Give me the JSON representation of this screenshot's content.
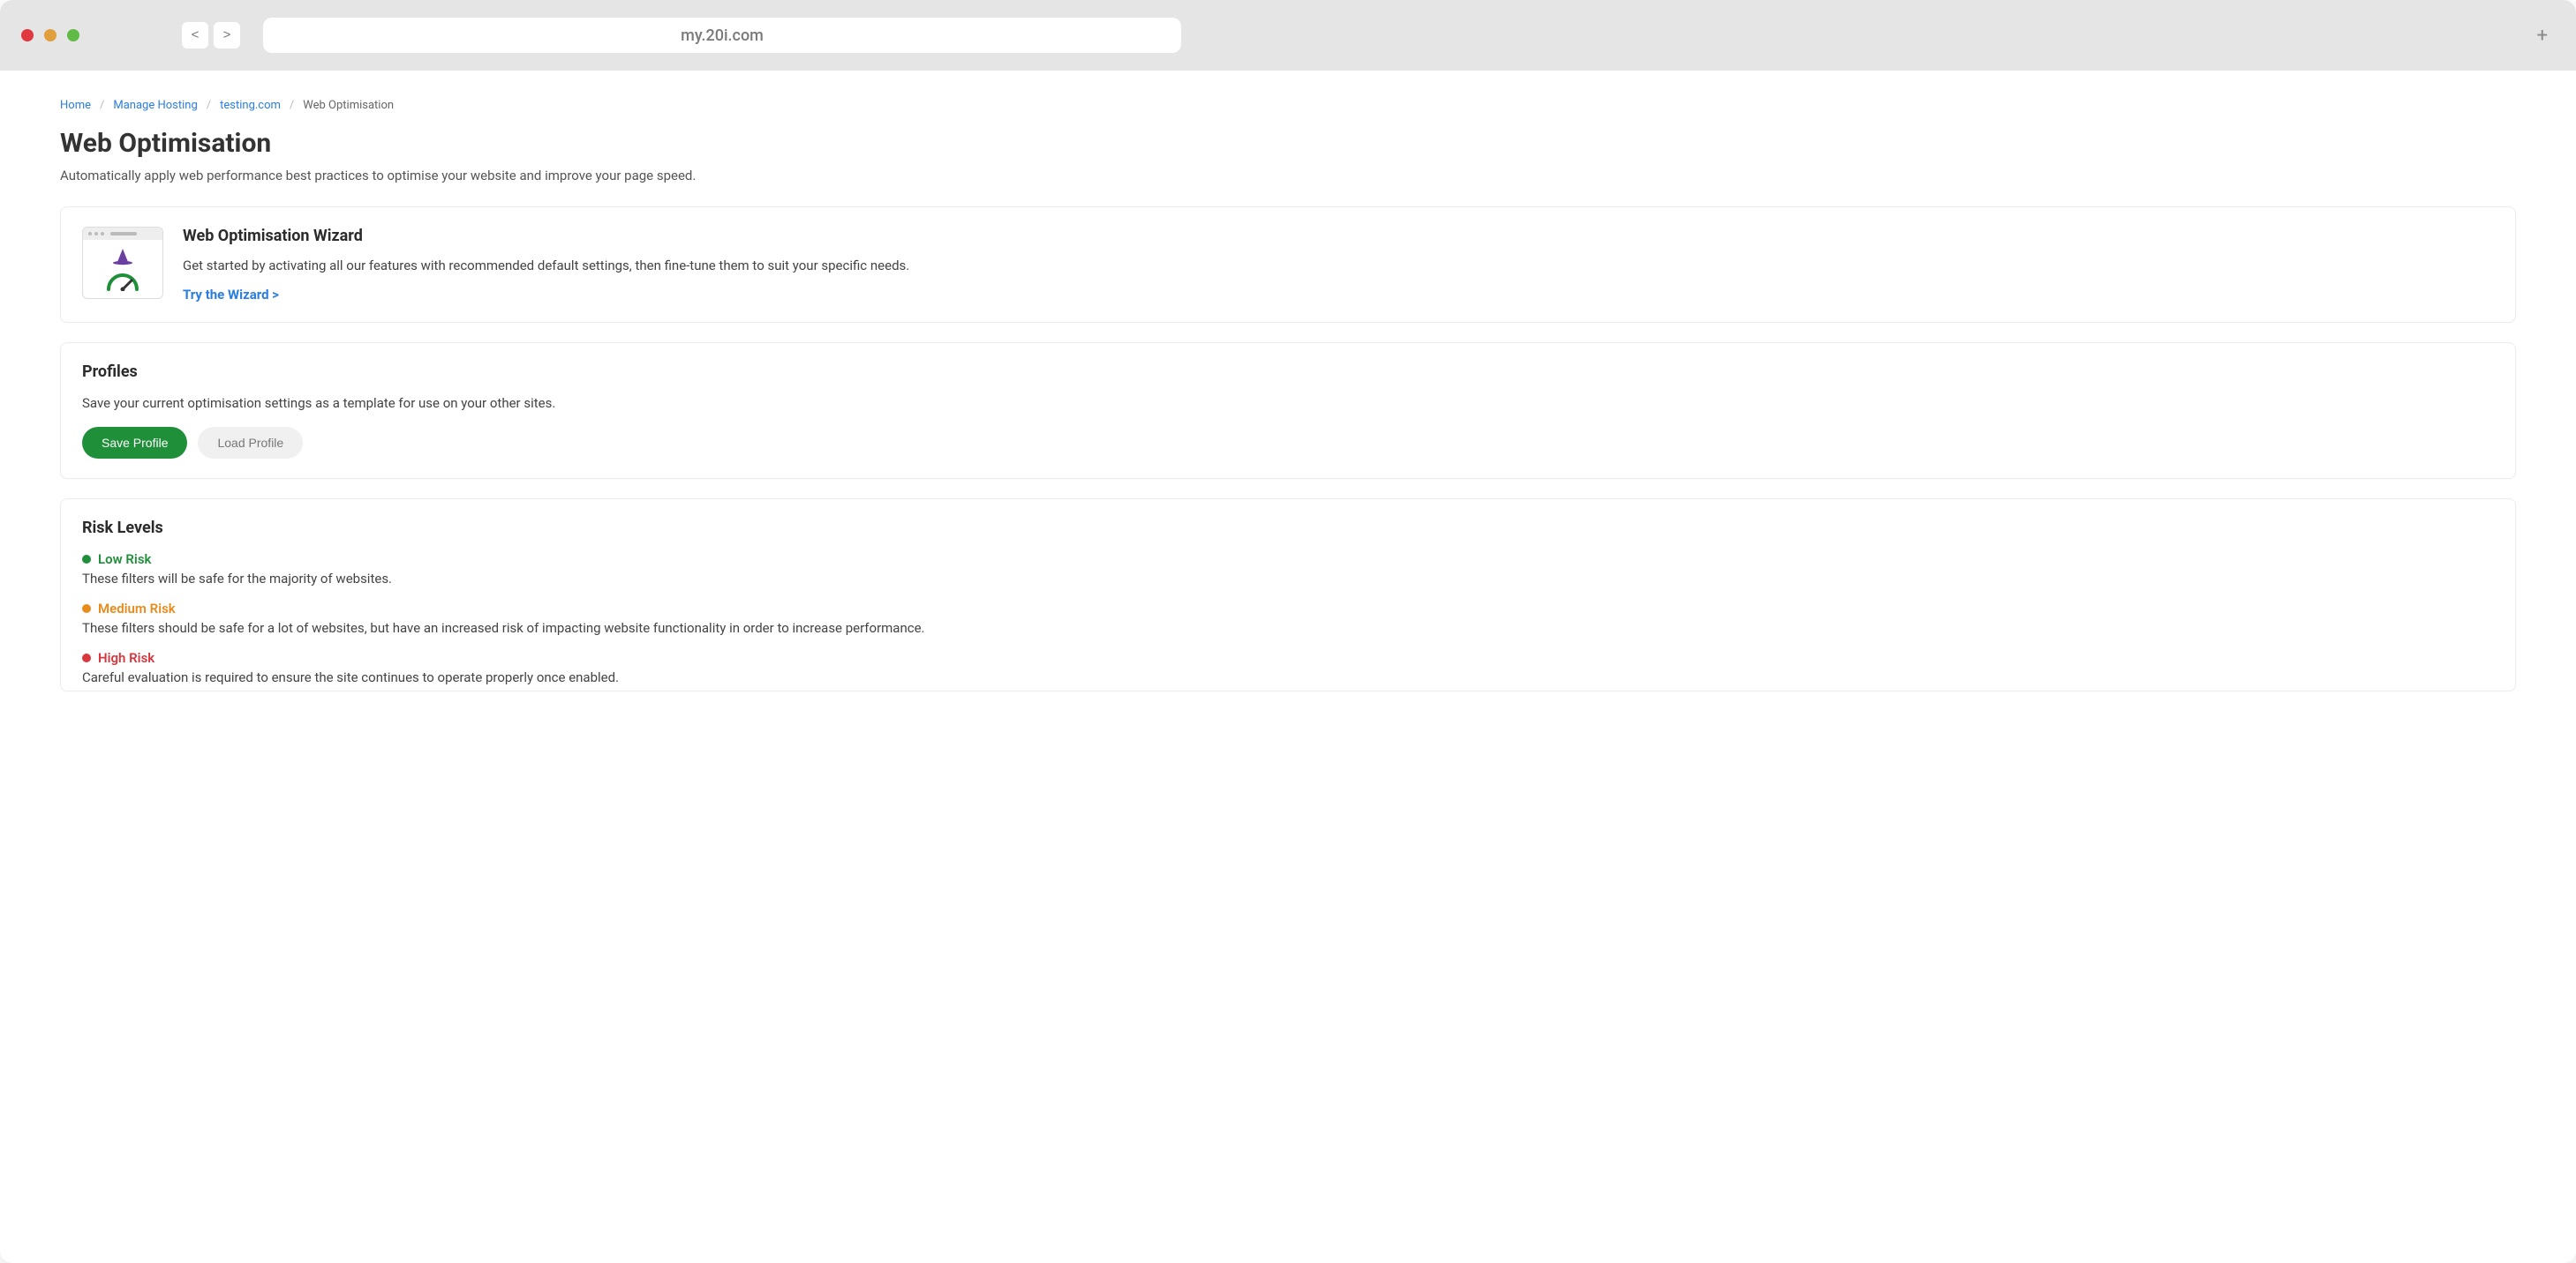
{
  "browser": {
    "url": "my.20i.com",
    "back_label": "<",
    "forward_label": ">",
    "new_tab_label": "+"
  },
  "breadcrumb": {
    "items": [
      {
        "label": "Home"
      },
      {
        "label": "Manage Hosting"
      },
      {
        "label": "testing.com"
      }
    ],
    "current": "Web Optimisation"
  },
  "page": {
    "title": "Web Optimisation",
    "subtitle": "Automatically apply web performance best practices to optimise your website and improve your page speed."
  },
  "wizard": {
    "title": "Web Optimisation Wizard",
    "description": "Get started by activating all our features with recommended default settings, then fine-tune them to suit your specific needs.",
    "link_label": "Try the Wizard >"
  },
  "profiles": {
    "heading": "Profiles",
    "description": "Save your current optimisation settings as a template for use on your other sites.",
    "save_label": "Save Profile",
    "load_label": "Load Profile"
  },
  "risk": {
    "heading": "Risk Levels",
    "levels": [
      {
        "name": "Low Risk",
        "class": "risk-low",
        "description": "These filters will be safe for the majority of websites."
      },
      {
        "name": "Medium Risk",
        "class": "risk-med",
        "description": "These filters should be safe for a lot of websites, but have an increased risk of impacting website functionality in order to increase performance."
      },
      {
        "name": "High Risk",
        "class": "risk-high",
        "description": "Careful evaluation is required to ensure the site continues to operate properly once enabled."
      }
    ]
  }
}
